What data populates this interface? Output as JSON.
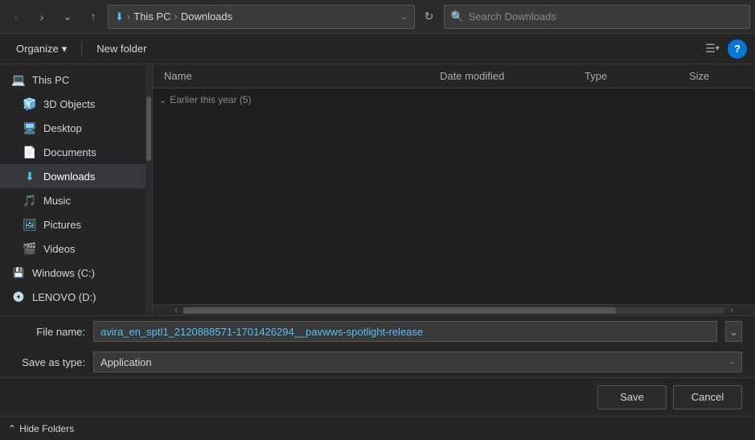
{
  "topbar": {
    "back_btn": "‹",
    "forward_btn": "›",
    "dropdown_btn": "⌄",
    "up_btn": "↑",
    "path_icon": "⬇",
    "path_parts": [
      "This PC",
      "Downloads"
    ],
    "address_chevron": "⌄",
    "refresh_btn": "↻",
    "search_placeholder": "Search Downloads",
    "search_icon": "🔍"
  },
  "toolbar": {
    "organize_label": "Organize",
    "organize_arrow": "▾",
    "new_folder_label": "New folder",
    "view_icon": "☰",
    "view_arrow": "▾",
    "help_label": "?"
  },
  "columns": {
    "name": "Name",
    "date_modified": "Date modified",
    "type": "Type",
    "size": "Size"
  },
  "file_group": {
    "label": "Earlier this year (5)",
    "chevron": "⌄"
  },
  "sidebar": {
    "items": [
      {
        "id": "thispc",
        "label": "This PC",
        "icon": "💻",
        "icon_class": "icon-thispc"
      },
      {
        "id": "3dobjects",
        "label": "3D Objects",
        "icon": "🧊",
        "icon_class": "icon-3d"
      },
      {
        "id": "desktop",
        "label": "Desktop",
        "icon": "🖥",
        "icon_class": "icon-desktop"
      },
      {
        "id": "documents",
        "label": "Documents",
        "icon": "📄",
        "icon_class": "icon-docs"
      },
      {
        "id": "downloads",
        "label": "Downloads",
        "icon": "⬇",
        "icon_class": "icon-downloads",
        "active": true
      },
      {
        "id": "music",
        "label": "Music",
        "icon": "🎵",
        "icon_class": "icon-music"
      },
      {
        "id": "pictures",
        "label": "Pictures",
        "icon": "🖼",
        "icon_class": "icon-pictures"
      },
      {
        "id": "videos",
        "label": "Videos",
        "icon": "🎬",
        "icon_class": "icon-videos"
      },
      {
        "id": "windowsc",
        "label": "Windows (C:)",
        "icon": "💾",
        "icon_class": "icon-winc"
      },
      {
        "id": "lenovod",
        "label": "LENOVO (D:)",
        "icon": "💿",
        "icon_class": "icon-lenovo"
      }
    ]
  },
  "bottom": {
    "file_name_label": "File name:",
    "file_name_value": "avira_en_sptl1_2120888571-1701426294__pavwws-spotlight-release",
    "save_as_type_label": "Save as type:",
    "save_as_type_value": "Application",
    "save_btn": "Save",
    "cancel_btn": "Cancel",
    "hide_folders_icon": "⌃",
    "hide_folders_label": "Hide Folders"
  }
}
